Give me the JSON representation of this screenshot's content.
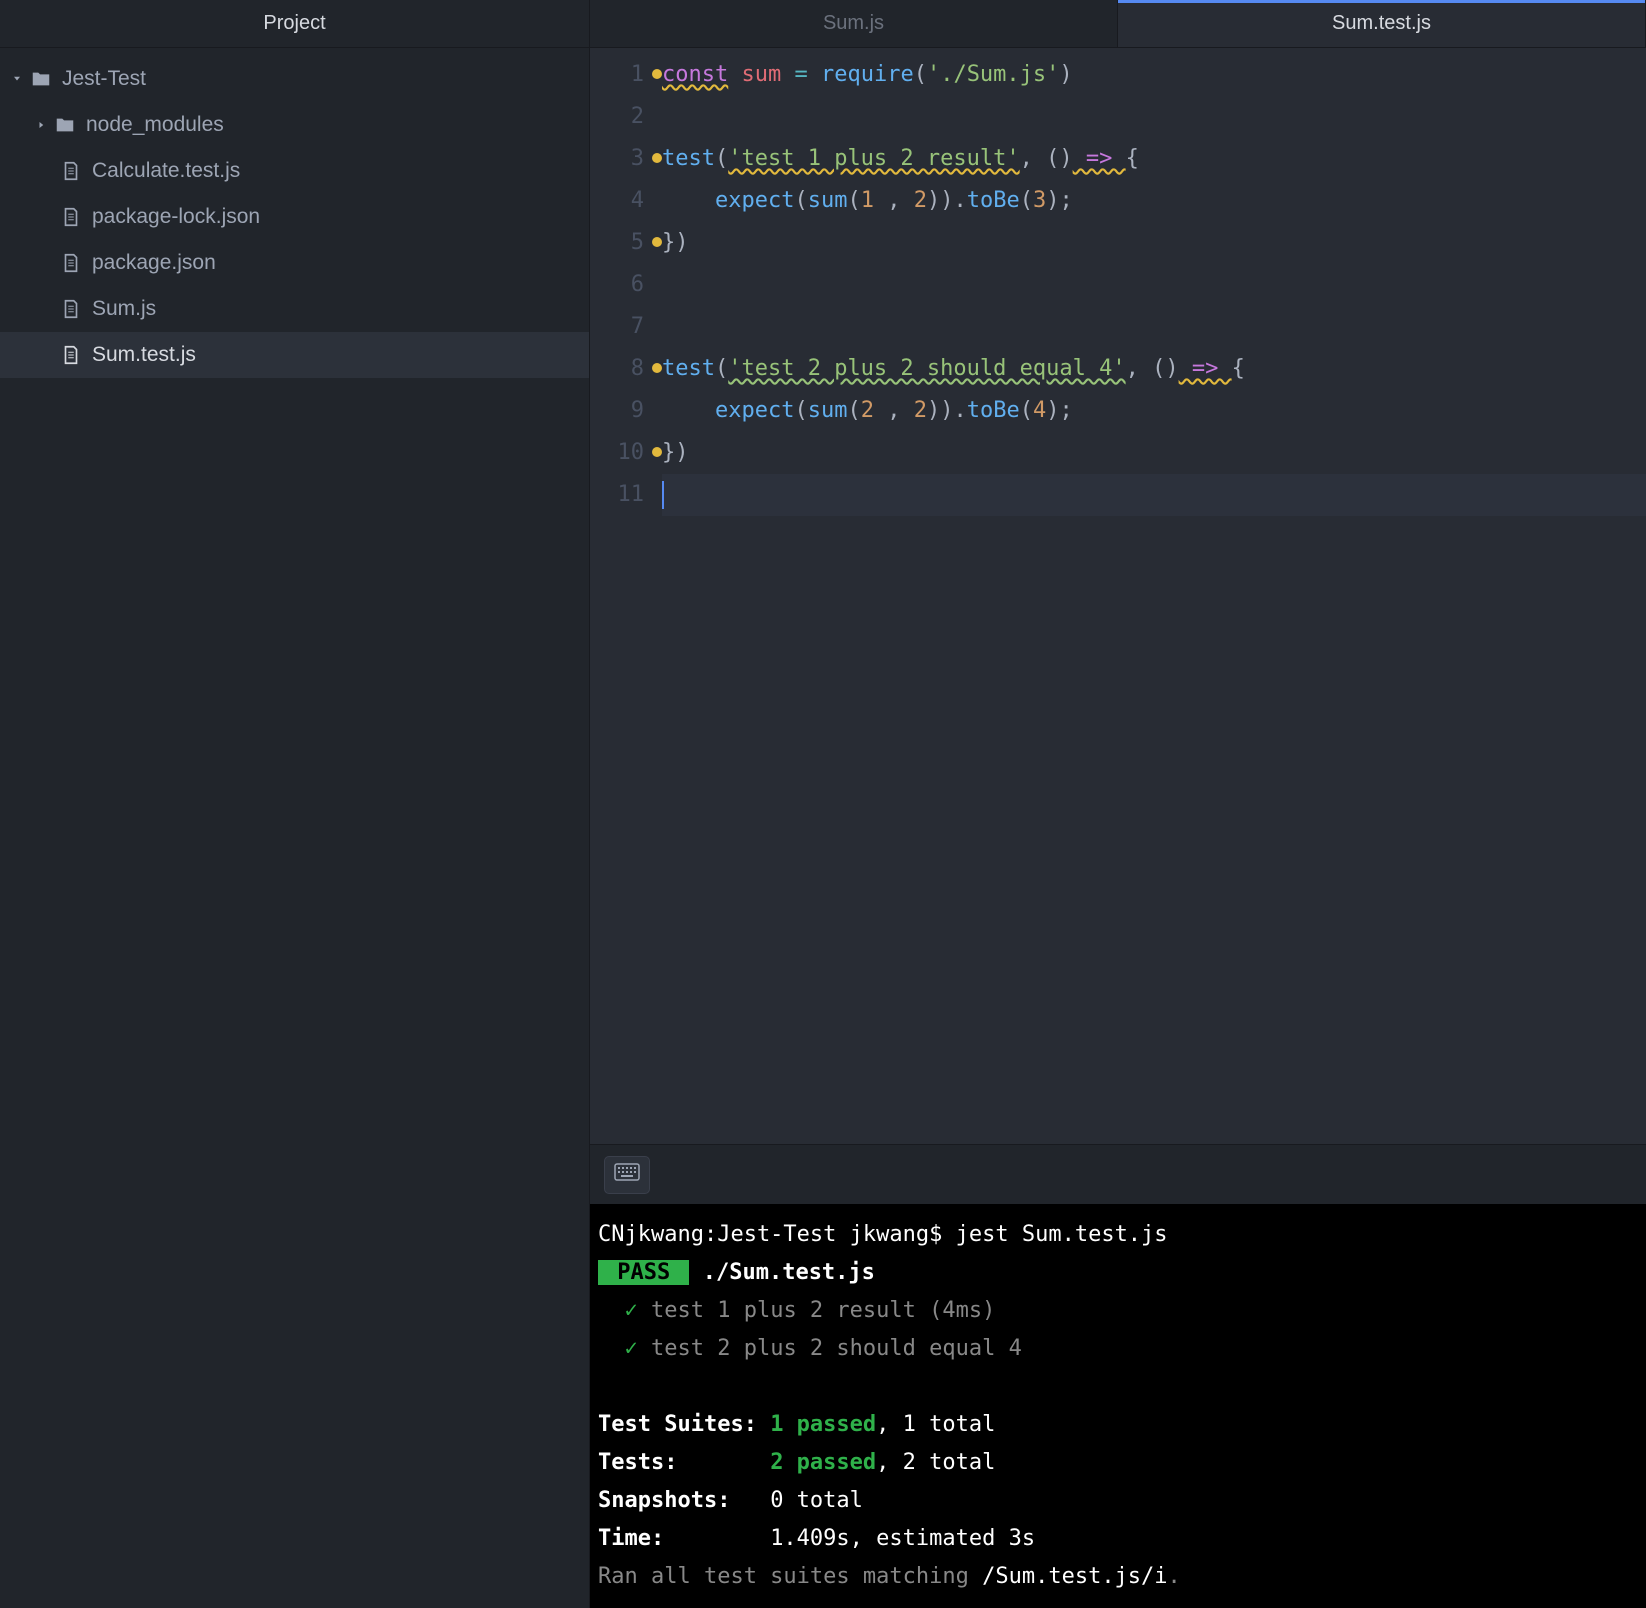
{
  "sidebar": {
    "title": "Project",
    "root": {
      "name": "Jest-Test",
      "expanded": true
    },
    "items": [
      {
        "name": "node_modules",
        "type": "folder",
        "expanded": false
      },
      {
        "name": "Calculate.test.js",
        "type": "file"
      },
      {
        "name": "package-lock.json",
        "type": "file"
      },
      {
        "name": "package.json",
        "type": "file"
      },
      {
        "name": "Sum.js",
        "type": "file"
      },
      {
        "name": "Sum.test.js",
        "type": "file",
        "selected": true
      }
    ]
  },
  "tabs": [
    {
      "label": "Sum.js",
      "active": false
    },
    {
      "label": "Sum.test.js",
      "active": true
    }
  ],
  "editor": {
    "lineNumbers": [
      "1",
      "2",
      "3",
      "4",
      "5",
      "6",
      "7",
      "8",
      "9",
      "10",
      "11"
    ],
    "code": {
      "l1": {
        "const": "const",
        "sum": "sum",
        "eq": "=",
        "require": "require",
        "p1": "(",
        "str": "'./Sum.js'",
        "p2": ")"
      },
      "l3": {
        "test": "test",
        "p1": "(",
        "str": "'test 1 plus 2 result'",
        "comma": ", ",
        "paren": "()",
        "arrow": " => ",
        "brace": "{"
      },
      "l4": {
        "indent": "    ",
        "expect": "expect",
        "p1": "(",
        "sum": "sum",
        "p2": "(",
        "n1": "1",
        "sep": " , ",
        "n2": "2",
        "p3": "))",
        "dot": ".",
        "tobe": "toBe",
        "p4": "(",
        "n3": "3",
        "p5": ");"
      },
      "l5": {
        "close": "})"
      },
      "l8": {
        "test": "test",
        "p1": "(",
        "str": "'test 2 plus 2 should equal 4'",
        "comma": ", ",
        "paren": "()",
        "arrow": " => ",
        "brace": "{"
      },
      "l9": {
        "indent": "    ",
        "expect": "expect",
        "p1": "(",
        "sum": "sum",
        "p2": "(",
        "n1": "2",
        "sep": " , ",
        "n2": "2",
        "p3": "))",
        "dot": ".",
        "tobe": "toBe",
        "p4": "(",
        "n3": "4",
        "p5": ");"
      },
      "l10": {
        "close": "})"
      }
    }
  },
  "terminal": {
    "prompt": "CNjkwang:Jest-Test jkwang$ ",
    "command": "jest Sum.test.js",
    "pass_badge": " PASS ",
    "pass_file": " ./Sum.test.js",
    "check": "✓",
    "test1": " test 1 plus 2 result (4ms)",
    "test2": " test 2 plus 2 should equal 4",
    "suites_label": "Test Suites: ",
    "suites_pass": "1 passed",
    "suites_rest": ", 1 total",
    "tests_label": "Tests:       ",
    "tests_pass": "2 passed",
    "tests_rest": ", 2 total",
    "snapshots_label": "Snapshots:   ",
    "snapshots_val": "0 total",
    "time_label": "Time:        ",
    "time_val": "1.409s, estimated 3s",
    "ran_line_pre": "Ran all test suites matching ",
    "ran_line_pattern": "/Sum.test.js/i",
    "ran_line_post": "."
  }
}
